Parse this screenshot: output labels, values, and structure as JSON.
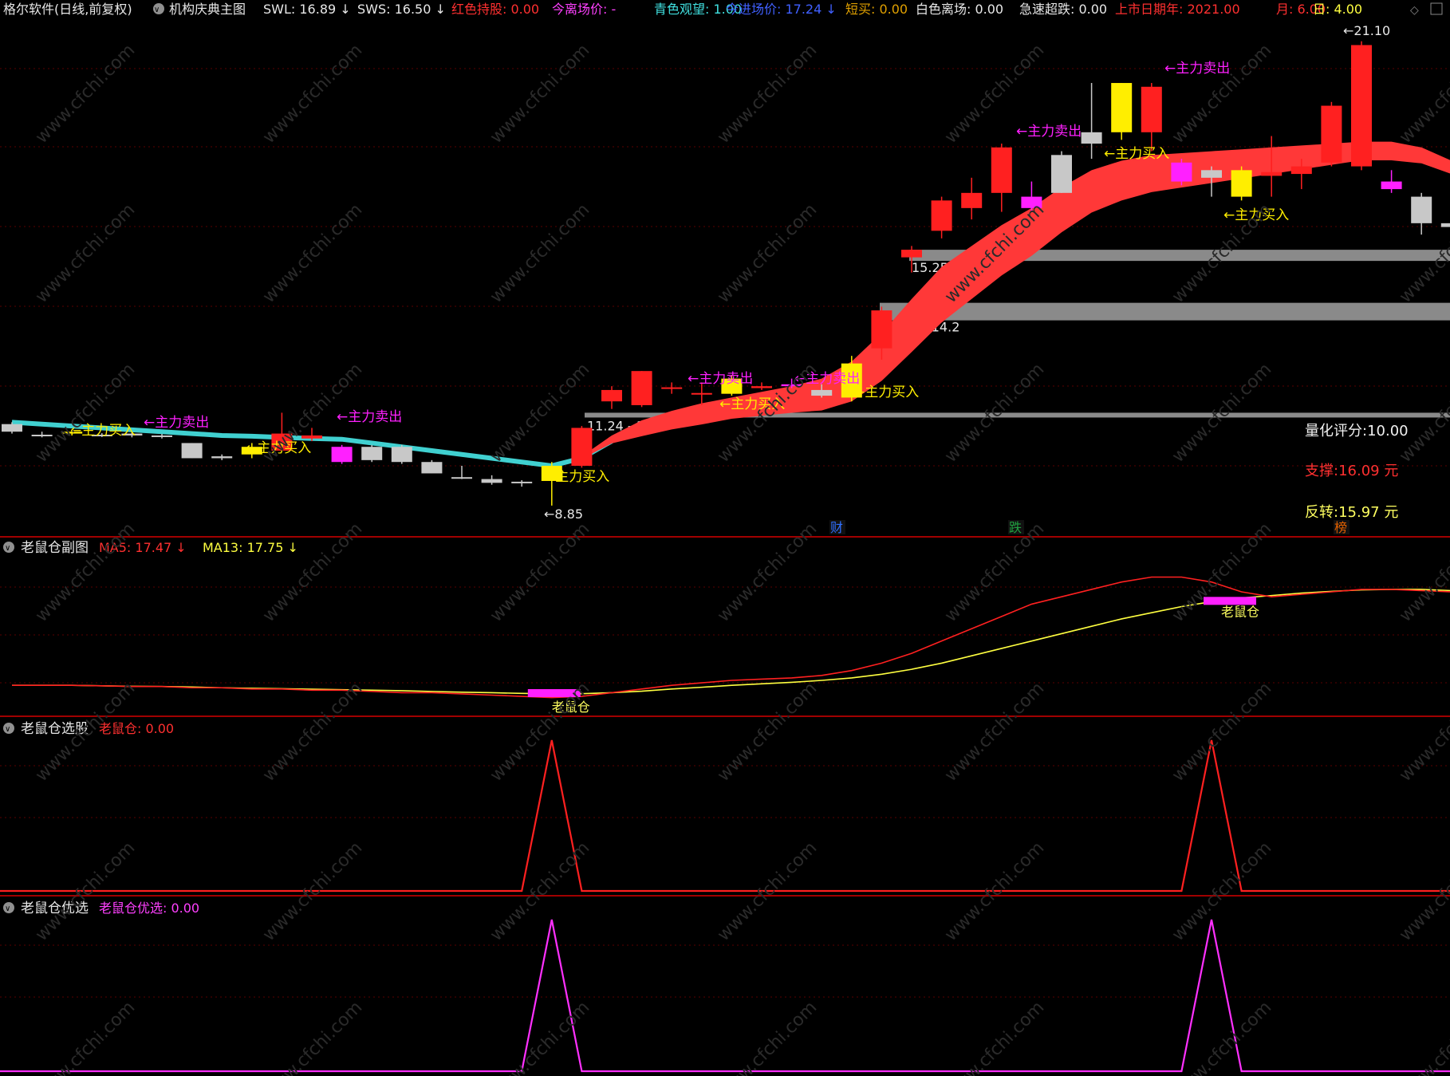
{
  "header": {
    "app_title": "格尔软件(日线,前复权)",
    "indicator_name": "机构庆典主图",
    "items": [
      {
        "label": "SWL: 16.89",
        "arrow": "↓",
        "color": "#e8e8e8"
      },
      {
        "label": "SWS: 16.50",
        "arrow": "↓",
        "color": "#e8e8e8"
      },
      {
        "label": "红色持股: 0.00",
        "arrow": "",
        "color": "#ff3030"
      },
      {
        "label": "今离场价: -",
        "arrow": "",
        "color": "#ff40ff"
      },
      {
        "label": "青色观望: 1.00",
        "arrow": "",
        "color": "#40e0e0"
      },
      {
        "label": "今进场价: 17.24",
        "arrow": "↓",
        "color": "#4060ff"
      },
      {
        "label": "短买: 0.00",
        "arrow": "",
        "color": "#e0a000"
      },
      {
        "label": "白色离场: 0.00",
        "arrow": "",
        "color": "#e8e8e8"
      },
      {
        "label": "急速超跌: 0.00",
        "arrow": "",
        "color": "#e8e8e8"
      },
      {
        "label": "上市日期年: 2021.00",
        "arrow": "",
        "color": "#ff3030"
      },
      {
        "label": "月: 6.00",
        "arrow": "",
        "color": "#ff3030"
      },
      {
        "label": "日: 4.00",
        "arrow": "",
        "color": "#ffff40"
      }
    ]
  },
  "watermark": "www.cfchi.com",
  "main_panel": {
    "price_labels": {
      "high": "21.10",
      "low": "8.85"
    },
    "support_zones": [
      {
        "label": "15.25 - 15.60",
        "low": 15.25,
        "high": 15.6
      },
      {
        "label": "13.86 - 14.2",
        "low": 13.86,
        "high": 14.2
      },
      {
        "label": "11.24 - 11.3",
        "low": 11.24,
        "high": 11.3
      }
    ],
    "annotations": {
      "buy": "←主力买入",
      "sell": "←主力卖出"
    },
    "info": {
      "score": "量化评分:10.00",
      "support": "支撑:16.09 元",
      "reversal": "反转:15.97 元"
    },
    "bottom_tags": [
      {
        "label": "财",
        "color": "#3070ff"
      },
      {
        "label": "跌",
        "color": "#20a040"
      },
      {
        "label": "榜",
        "color": "#e06000"
      }
    ],
    "colors": {
      "up": "#ff2020",
      "down_gray": "#c8c8c8",
      "yellow": "#ffee00",
      "magenta": "#ff20ff",
      "cyan": "#40d0d0",
      "band": "#ff3838"
    }
  },
  "sub1": {
    "name": "老鼠仓副图",
    "items": [
      {
        "label": "MA5: 17.47",
        "arrow": "↓",
        "color": "#ff3030"
      },
      {
        "label": "MA13: 17.75",
        "arrow": "↓",
        "color": "#ffff40"
      }
    ],
    "marker_label": "老鼠仓"
  },
  "sub2": {
    "name": "老鼠仓选股",
    "items": [
      {
        "label": "老鼠仓: 0.00",
        "color": "#ff3030"
      }
    ]
  },
  "sub3": {
    "name": "老鼠仓优选",
    "items": [
      {
        "label": "老鼠仓优选: 0.00",
        "color": "#ff40ff"
      }
    ]
  },
  "chart_data": {
    "type": "candlestick",
    "title": "格尔软件(日线,前复权)",
    "ylim": [
      8.3,
      21.6
    ],
    "candles": [
      {
        "o": 11.0,
        "c": 10.8,
        "h": 11.05,
        "l": 10.75,
        "t": "g"
      },
      {
        "o": 10.72,
        "c": 10.7,
        "h": 10.8,
        "l": 10.65,
        "t": "g"
      },
      {
        "o": 10.8,
        "c": 10.75,
        "h": 10.85,
        "l": 10.7,
        "t": "y"
      },
      {
        "o": 10.72,
        "c": 10.7,
        "h": 10.76,
        "l": 10.66,
        "t": "g"
      },
      {
        "o": 10.75,
        "c": 10.7,
        "h": 10.8,
        "l": 10.65,
        "t": "g"
      },
      {
        "o": 10.7,
        "c": 10.68,
        "h": 10.74,
        "l": 10.62,
        "t": "g"
      },
      {
        "o": 10.5,
        "c": 10.1,
        "h": 10.5,
        "l": 10.1,
        "t": "g"
      },
      {
        "o": 10.15,
        "c": 10.1,
        "h": 10.2,
        "l": 10.05,
        "t": "g"
      },
      {
        "o": 10.4,
        "c": 10.2,
        "h": 10.5,
        "l": 10.1,
        "t": "y"
      },
      {
        "o": 10.3,
        "c": 10.75,
        "h": 11.3,
        "l": 10.3,
        "t": "r"
      },
      {
        "o": 10.62,
        "c": 10.7,
        "h": 10.9,
        "l": 10.55,
        "t": "r"
      },
      {
        "o": 10.4,
        "c": 10.0,
        "h": 10.45,
        "l": 9.95,
        "t": "m"
      },
      {
        "o": 10.4,
        "c": 10.05,
        "h": 10.45,
        "l": 10.0,
        "t": "g"
      },
      {
        "o": 10.4,
        "c": 10.0,
        "h": 10.45,
        "l": 9.95,
        "t": "g"
      },
      {
        "o": 10.0,
        "c": 9.7,
        "h": 10.05,
        "l": 9.7,
        "t": "g"
      },
      {
        "o": 9.6,
        "c": 9.58,
        "h": 9.9,
        "l": 9.55,
        "t": "g"
      },
      {
        "o": 9.55,
        "c": 9.45,
        "h": 9.65,
        "l": 9.4,
        "t": "g"
      },
      {
        "o": 9.48,
        "c": 9.45,
        "h": 9.52,
        "l": 9.35,
        "t": "g"
      },
      {
        "o": 9.9,
        "c": 9.5,
        "h": 10.0,
        "l": 8.85,
        "t": "y"
      },
      {
        "o": 9.9,
        "c": 10.9,
        "h": 10.95,
        "l": 9.85,
        "t": "r"
      },
      {
        "o": 11.6,
        "c": 11.9,
        "h": 12.0,
        "l": 11.4,
        "t": "r"
      },
      {
        "o": 11.5,
        "c": 12.4,
        "h": 12.4,
        "l": 11.45,
        "t": "r"
      },
      {
        "o": 11.95,
        "c": 11.97,
        "h": 12.1,
        "l": 11.8,
        "t": "r"
      },
      {
        "o": 11.8,
        "c": 11.82,
        "h": 12.1,
        "l": 11.5,
        "t": "r"
      },
      {
        "o": 11.8,
        "c": 12.2,
        "h": 12.3,
        "l": 11.75,
        "t": "y"
      },
      {
        "o": 11.95,
        "c": 12.0,
        "h": 12.1,
        "l": 11.9,
        "t": "r"
      },
      {
        "o": 12.0,
        "c": 12.05,
        "h": 12.2,
        "l": 11.95,
        "t": "m"
      },
      {
        "o": 11.9,
        "c": 11.75,
        "h": 12.05,
        "l": 11.7,
        "t": "g"
      },
      {
        "o": 11.7,
        "c": 12.6,
        "h": 12.8,
        "l": 11.6,
        "t": "y"
      },
      {
        "o": 13.0,
        "c": 14.0,
        "h": 14.1,
        "l": 12.7,
        "t": "r"
      },
      {
        "o": 15.4,
        "c": 15.6,
        "h": 15.7,
        "l": 15.0,
        "t": "r"
      },
      {
        "o": 16.1,
        "c": 16.9,
        "h": 17.0,
        "l": 15.9,
        "t": "r"
      },
      {
        "o": 16.7,
        "c": 17.1,
        "h": 17.5,
        "l": 16.4,
        "t": "r"
      },
      {
        "o": 17.1,
        "c": 18.3,
        "h": 18.4,
        "l": 16.6,
        "t": "r"
      },
      {
        "o": 17.0,
        "c": 16.7,
        "h": 17.4,
        "l": 16.6,
        "t": "m"
      },
      {
        "o": 18.1,
        "c": 17.1,
        "h": 18.2,
        "l": 17.1,
        "t": "g"
      },
      {
        "o": 18.7,
        "c": 18.4,
        "h": 20.0,
        "l": 18.0,
        "t": "g"
      },
      {
        "o": 18.7,
        "c": 20.0,
        "h": 20.0,
        "l": 18.5,
        "t": "y"
      },
      {
        "o": 18.7,
        "c": 19.9,
        "h": 20.0,
        "l": 18.2,
        "t": "r"
      },
      {
        "o": 17.9,
        "c": 17.4,
        "h": 18.0,
        "l": 17.3,
        "t": "m"
      },
      {
        "o": 17.7,
        "c": 17.5,
        "h": 17.8,
        "l": 17.0,
        "t": "g"
      },
      {
        "o": 17.7,
        "c": 17.0,
        "h": 17.8,
        "l": 16.9,
        "t": "y"
      },
      {
        "o": 17.55,
        "c": 17.65,
        "h": 18.6,
        "l": 17.0,
        "t": "r"
      },
      {
        "o": 17.6,
        "c": 17.8,
        "h": 18.0,
        "l": 17.2,
        "t": "r"
      },
      {
        "o": 17.9,
        "c": 19.4,
        "h": 19.5,
        "l": 17.8,
        "t": "r"
      },
      {
        "o": 17.8,
        "c": 21.0,
        "h": 21.1,
        "l": 17.7,
        "t": "r"
      },
      {
        "o": 17.4,
        "c": 17.2,
        "h": 17.7,
        "l": 17.1,
        "t": "m"
      },
      {
        "o": 17.0,
        "c": 16.3,
        "h": 17.1,
        "l": 16.0,
        "t": "g"
      },
      {
        "o": 16.3,
        "c": 16.2,
        "h": 16.4,
        "l": 15.8,
        "t": "g"
      }
    ],
    "trend_line": [
      11.05,
      11.0,
      10.95,
      10.9,
      10.85,
      10.8,
      10.75,
      10.7,
      10.68,
      10.65,
      10.62,
      10.6,
      10.5,
      10.4,
      10.3,
      10.2,
      10.1,
      10.0,
      9.9,
      10.1,
      10.55,
      10.8,
      11.0,
      11.15,
      11.3,
      11.4,
      11.5,
      11.6,
      11.9,
      12.5,
      13.3,
      14.1,
      14.7,
      15.3,
      15.8,
      16.4,
      16.9,
      17.2,
      17.4,
      17.5,
      17.6,
      17.7,
      17.8,
      17.9,
      18.0,
      18.1,
      18.1,
      18.0,
      17.7
    ],
    "band_width": [
      0,
      0,
      0,
      0,
      0,
      0,
      0,
      0,
      0,
      0,
      0,
      0,
      0,
      0,
      0,
      0,
      0,
      0,
      0,
      0.05,
      0.15,
      0.3,
      0.35,
      0.4,
      0.4,
      0.45,
      0.5,
      0.6,
      0.75,
      0.9,
      1.0,
      1.05,
      1.0,
      0.95,
      0.9,
      0.85,
      0.8,
      0.75,
      0.7,
      0.65,
      0.6,
      0.55,
      0.5,
      0.45,
      0.4,
      0.35,
      0.35,
      0.3,
      0.25
    ],
    "sub1_ma5": [
      17.0,
      17.0,
      17.0,
      16.98,
      16.95,
      16.95,
      16.9,
      16.9,
      16.85,
      16.85,
      16.8,
      16.8,
      16.75,
      16.7,
      16.7,
      16.65,
      16.6,
      16.55,
      16.5,
      16.55,
      16.7,
      16.85,
      17.0,
      17.1,
      17.2,
      17.25,
      17.3,
      17.4,
      17.6,
      17.9,
      18.3,
      18.8,
      19.3,
      19.8,
      20.3,
      20.6,
      20.9,
      21.2,
      21.4,
      21.4,
      21.2,
      20.8,
      20.6,
      20.7,
      20.8,
      20.9,
      20.9,
      20.85,
      20.8
    ],
    "sub1_ma13": [
      17.0,
      17.0,
      17.0,
      16.98,
      16.96,
      16.95,
      16.93,
      16.9,
      16.88,
      16.86,
      16.84,
      16.82,
      16.8,
      16.78,
      16.75,
      16.72,
      16.7,
      16.67,
      16.65,
      16.66,
      16.7,
      16.76,
      16.85,
      16.92,
      17.0,
      17.06,
      17.12,
      17.2,
      17.3,
      17.45,
      17.65,
      17.9,
      18.2,
      18.5,
      18.8,
      19.1,
      19.4,
      19.7,
      19.95,
      20.2,
      20.4,
      20.55,
      20.65,
      20.75,
      20.82,
      20.88,
      20.9,
      20.9,
      20.85
    ],
    "signals": [
      18,
      40
    ]
  }
}
